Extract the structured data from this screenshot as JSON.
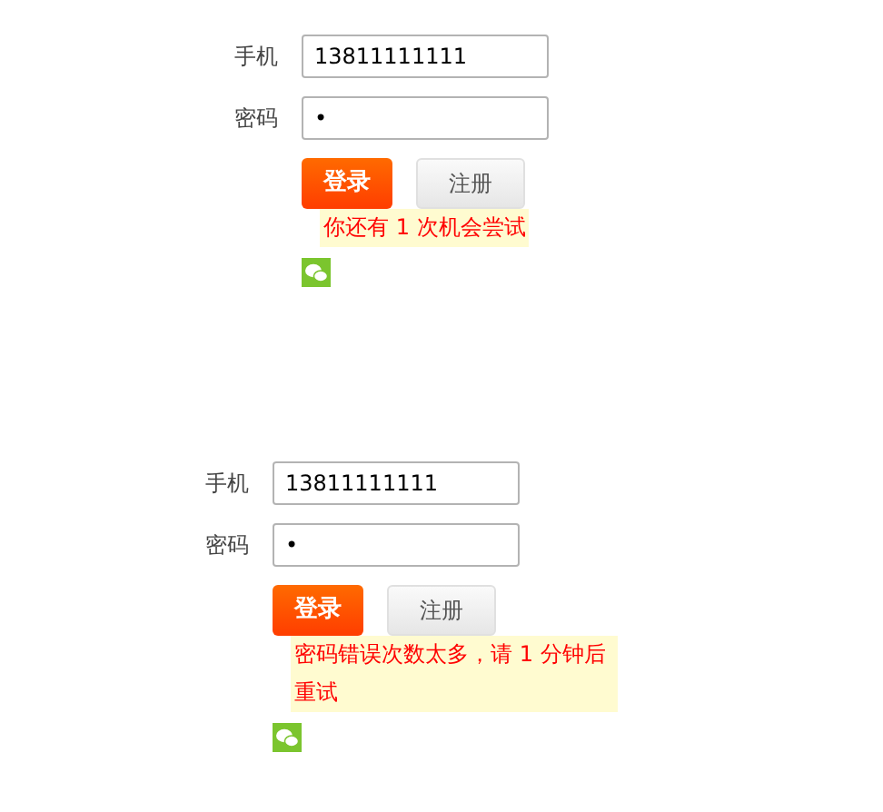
{
  "forms": [
    {
      "phone_label": "手机",
      "phone_value": "13811111111",
      "password_label": "密码",
      "password_value": "•",
      "login_button": "登录",
      "register_button": "注册",
      "message": "你还有 1 次机会尝试"
    },
    {
      "phone_label": "手机",
      "phone_value": "13811111111",
      "password_label": "密码",
      "password_value": "•",
      "login_button": "登录",
      "register_button": "注册",
      "message": "密码错误次数太多，请 1 分钟后重试"
    }
  ]
}
